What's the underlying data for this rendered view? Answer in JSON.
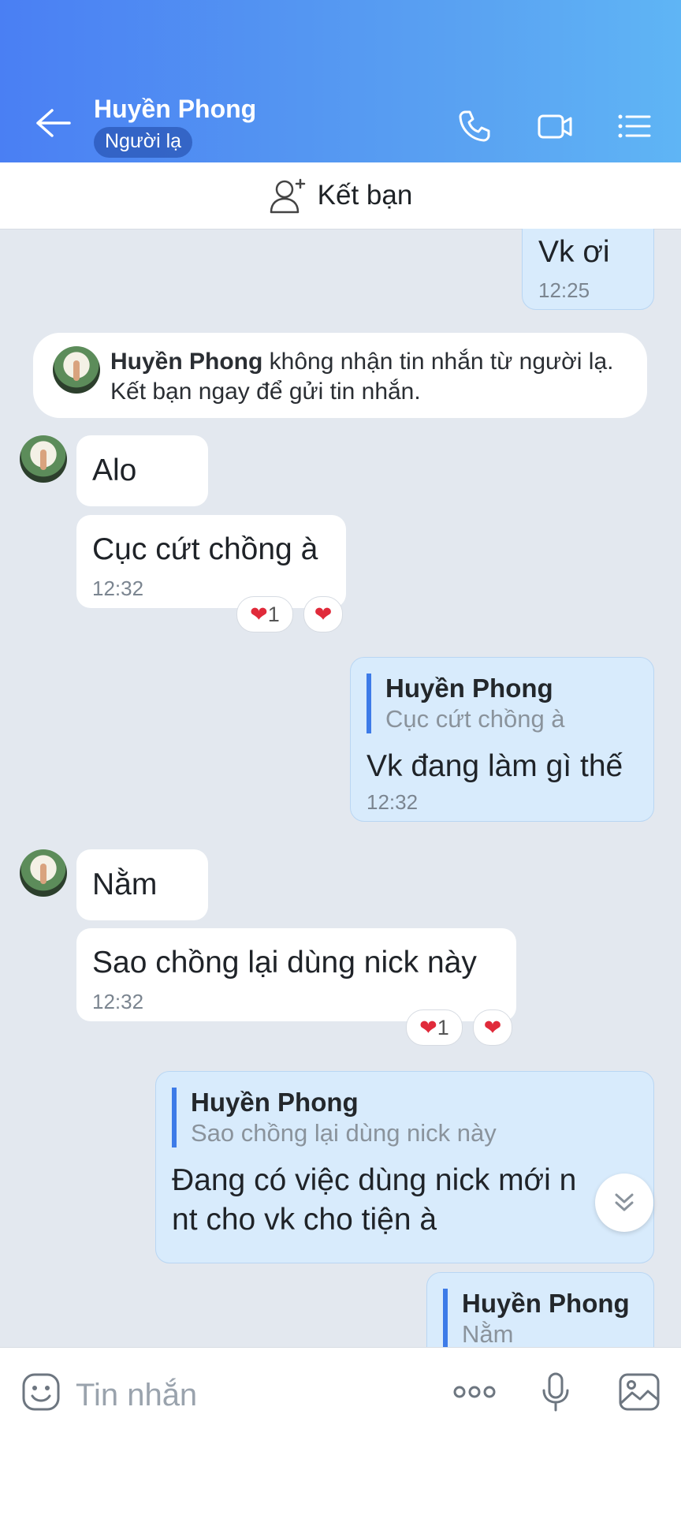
{
  "header": {
    "title": "Huyền Phong",
    "badge": "Người lạ",
    "icons": [
      "back-arrow-icon",
      "phone-icon",
      "video-call-icon",
      "menu-list-icon"
    ],
    "color_start": "#4a7ff3",
    "color_end": "#5fb5f5"
  },
  "friend_bar": {
    "label": "Kết bạn",
    "icon": "add-person-icon"
  },
  "notice": {
    "name": "Huyền Phong",
    "line1_rest": " không nhận tin nhắn từ người lạ.",
    "line2": "Kết bạn ngay để gửi tin nhắn."
  },
  "messages": [
    {
      "dir": "out",
      "text": "Vk ơi",
      "time": "12:25"
    },
    {
      "dir": "in",
      "text": "Alo"
    },
    {
      "dir": "in",
      "text": "Cục cứt chồng à",
      "time": "12:32",
      "reaction_count": "1"
    },
    {
      "dir": "out",
      "quote_name": "Huyền Phong",
      "quote_text": "Cục cứt chồng à",
      "text": "Vk đang làm gì thế",
      "time": "12:32"
    },
    {
      "dir": "in",
      "text": "Nằm"
    },
    {
      "dir": "in",
      "text": "Sao chồng lại dùng nick này",
      "time": "12:32",
      "reaction_count": "1"
    },
    {
      "dir": "out",
      "quote_name": "Huyền Phong",
      "quote_text": "Sao chồng lại dùng nick này",
      "text_line1": "Đang có việc dùng nick mới n",
      "text_line2": "nt cho vk cho tiện à"
    },
    {
      "dir": "out",
      "quote_name": "Huyền Phong",
      "quote_text": "Nằm"
    }
  ],
  "input": {
    "placeholder": "Tin nhắn",
    "icons": [
      "sticker-icon",
      "more-icon",
      "microphone-icon",
      "image-icon"
    ]
  }
}
